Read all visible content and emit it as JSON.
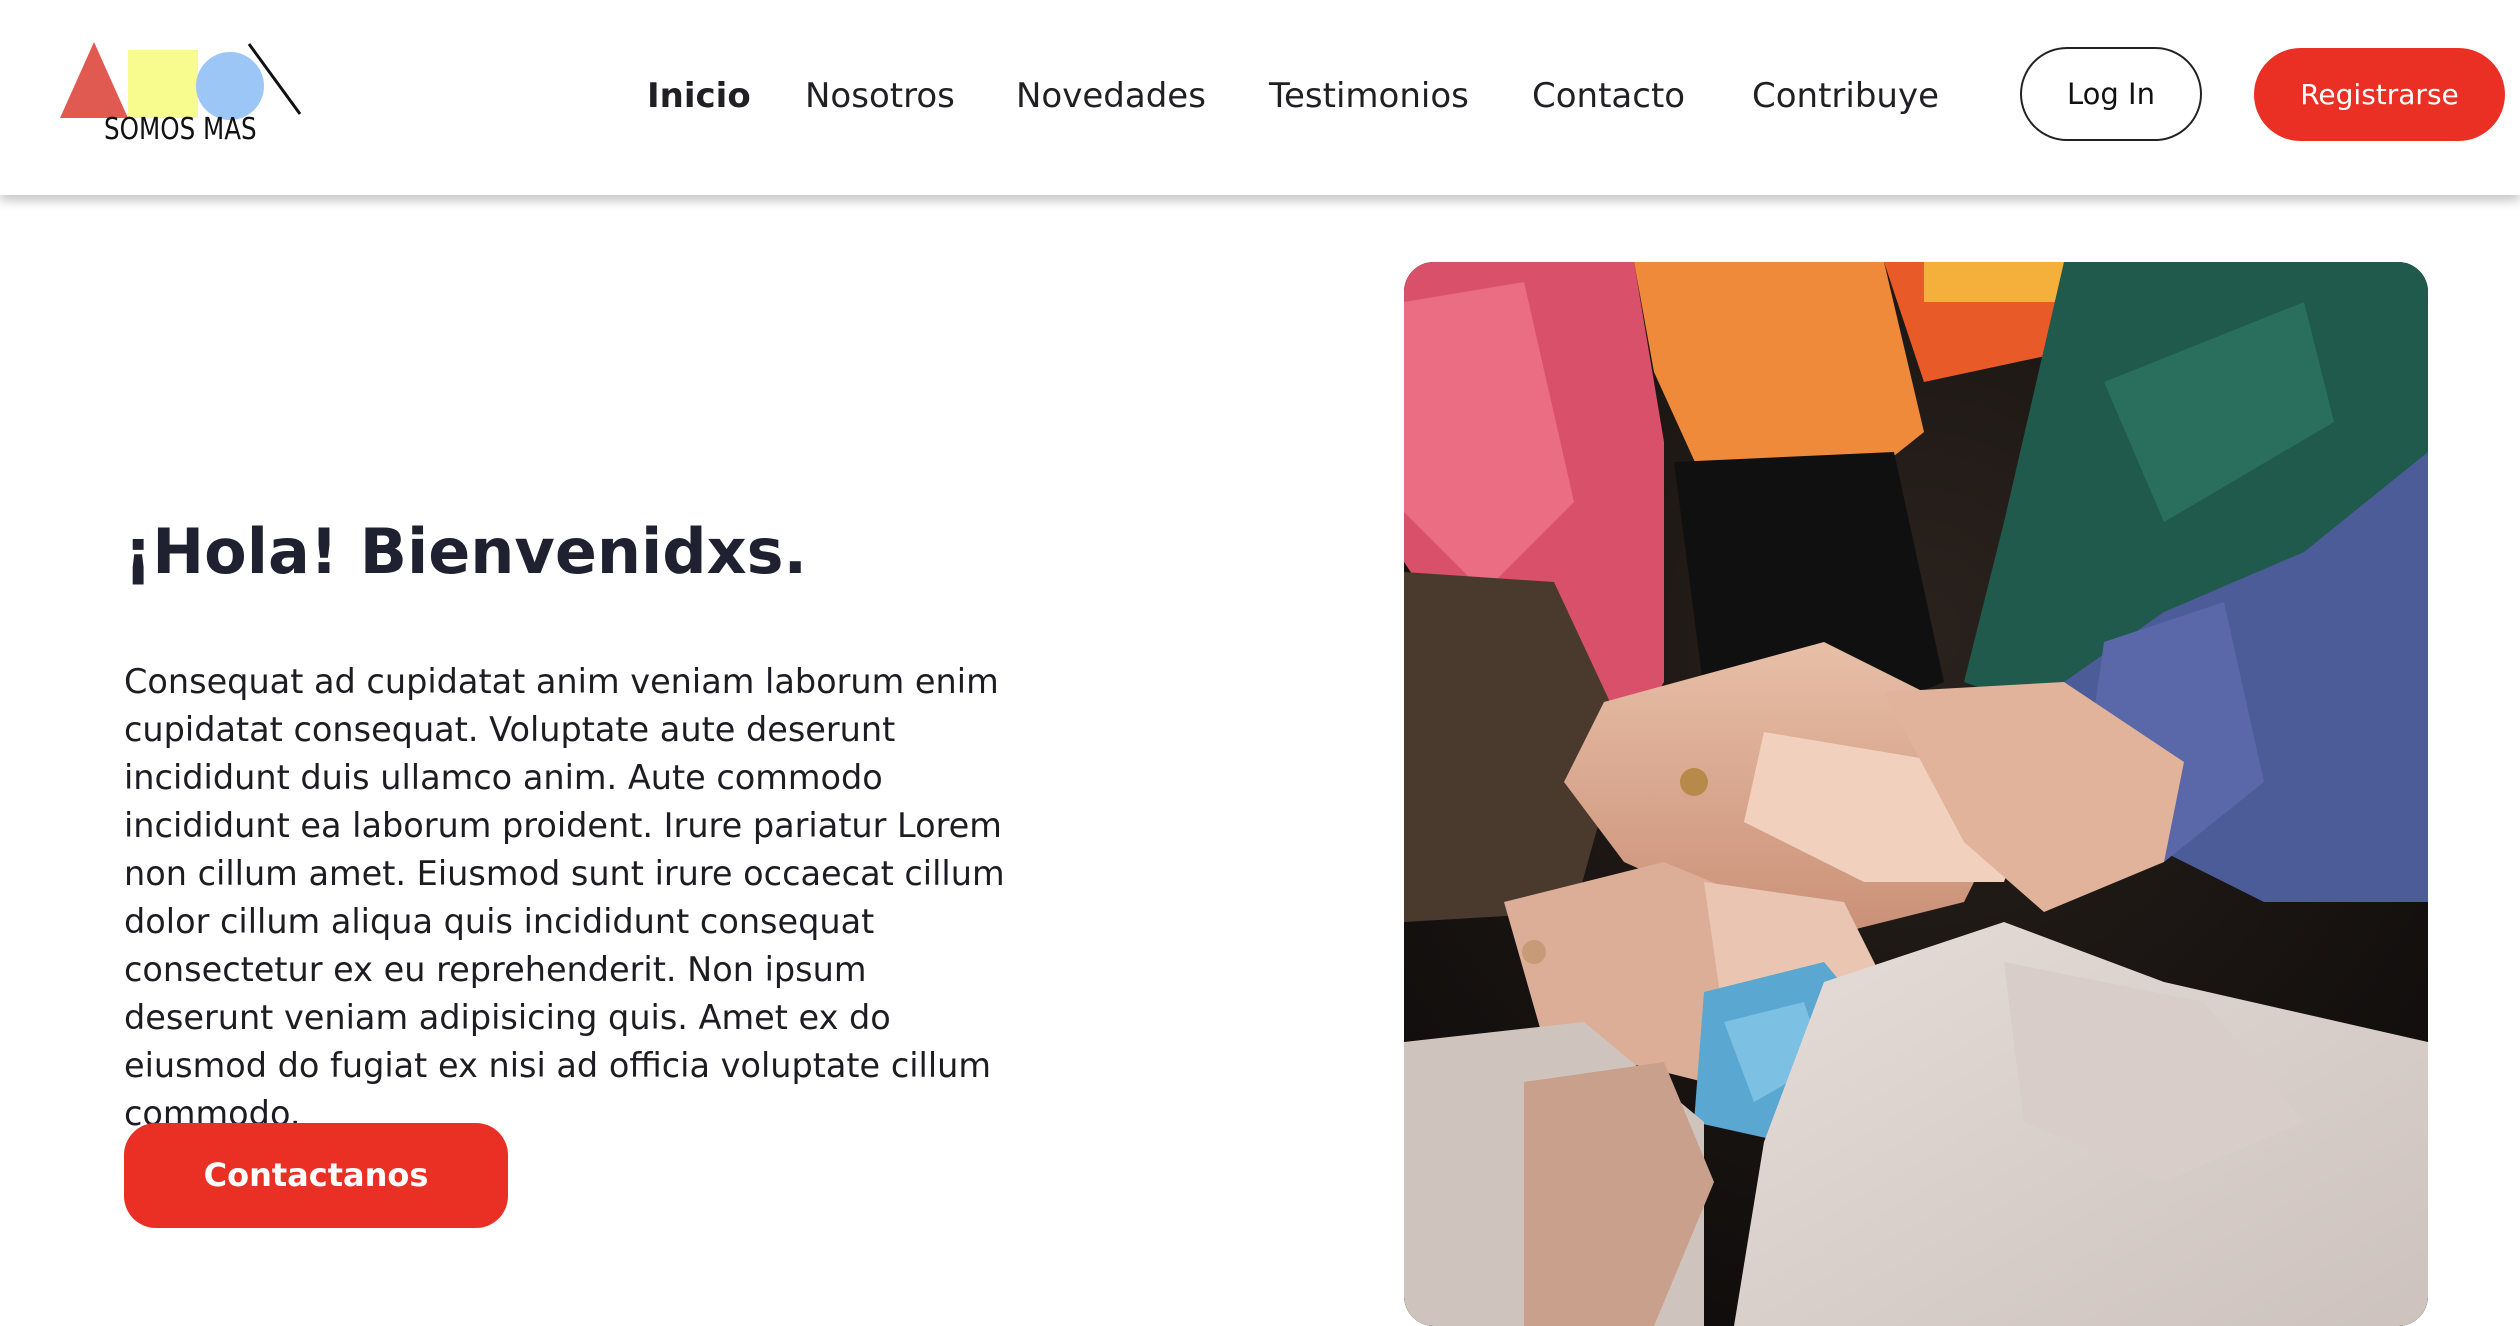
{
  "brand": {
    "logo_text": "SOMOS MAS",
    "colors": {
      "triangle": "#e05a52",
      "square": "#f8fb8e",
      "circle": "#9cc6f5",
      "line": "#111111"
    }
  },
  "nav": {
    "items": [
      {
        "label": "Inicio",
        "active": true
      },
      {
        "label": "Nosotros"
      },
      {
        "label": "Novedades"
      },
      {
        "label": "Testimonios"
      },
      {
        "label": "Contacto"
      },
      {
        "label": "Contribuye"
      }
    ]
  },
  "auth": {
    "login_label": "Log In",
    "register_label": "Registrarse"
  },
  "hero": {
    "title": "¡Hola! Bienvenidxs.",
    "body": "Consequat ad cupidatat anim veniam laborum enim cupidatat consequat. Voluptate aute deserunt incididunt duis ullamco anim. Aute commodo incididunt ea laborum proident. Irure pariatur Lorem non cillum amet. Eiusmod sunt irure occaecat cillum dolor cillum aliqua quis incididunt consequat consectetur ex eu reprehenderit. Non ipsum deserunt veniam adipisicing quis. Amet ex do eiusmod do fugiat ex nisi ad officia voluptate cillum commodo.",
    "cta_label": "Contactanos",
    "image_subject": "stacked-hands-photo"
  },
  "theme": {
    "accent": "#ea2f24",
    "text": "#1f1f24"
  }
}
